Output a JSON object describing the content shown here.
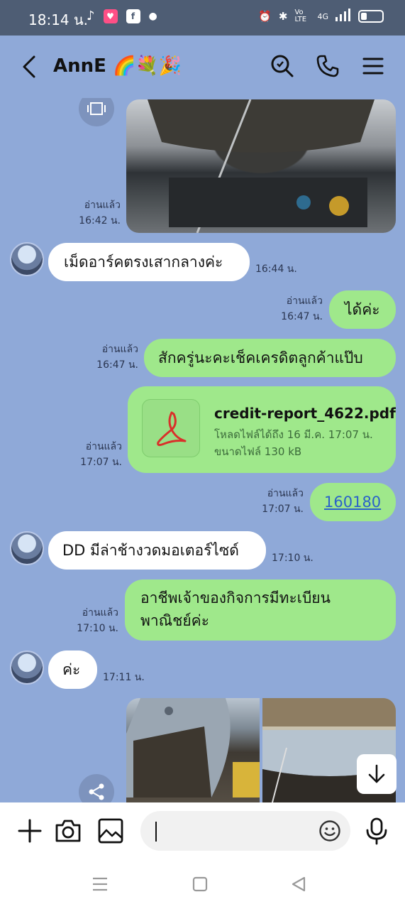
{
  "status": {
    "time": "18:14 น.",
    "volte": "Vo LTE",
    "net": "4G",
    "battery_level": 0.3
  },
  "header": {
    "title": "AnnE 🌈💐🎉"
  },
  "messages": {
    "m1": {
      "read": "อ่านแล้ว",
      "time": "16:42 น."
    },
    "m2": {
      "text": "เม็ดอาร์คตรงเสากลางค่ะ",
      "time": "16:44 น."
    },
    "m3": {
      "text": "ได้ค่ะ",
      "read": "อ่านแล้ว",
      "time": "16:47 น."
    },
    "m4": {
      "text": "สักครู่นะคะเช็คเครดิตลูกค้าแป๊บ",
      "read": "อ่านแล้ว",
      "time": "16:47 น."
    },
    "m5": {
      "file_name": "credit-report_4622.pdf",
      "line1": "โหลดไฟล์ได้ถึง 16 มี.ค. 17:07 น.",
      "line2": "ขนาดไฟล์ 130 kB",
      "read": "อ่านแล้ว",
      "time": "17:07 น."
    },
    "m6": {
      "text": "160180",
      "read": "อ่านแล้ว",
      "time": "17:07 น."
    },
    "m7": {
      "text": "DD มีล่าช้างวดมอเตอร์ไซด์",
      "time": "17:10 น."
    },
    "m8": {
      "text_line1": "อาชีพเจ้าของกิจการมีทะเบียน",
      "text_line2": "พาณิชย์ค่ะ",
      "read": "อ่านแล้ว",
      "time": "17:10 น."
    },
    "m9": {
      "text": "ค่ะ",
      "time": "17:11 น."
    }
  },
  "input": {
    "placeholder": "",
    "value": ""
  },
  "colors": {
    "background": "#8fa9d8",
    "mine_bubble": "#9fe88b",
    "their_bubble": "#ffffff",
    "status_bar": "#4e5d74",
    "pdf_red": "#d9302a"
  }
}
